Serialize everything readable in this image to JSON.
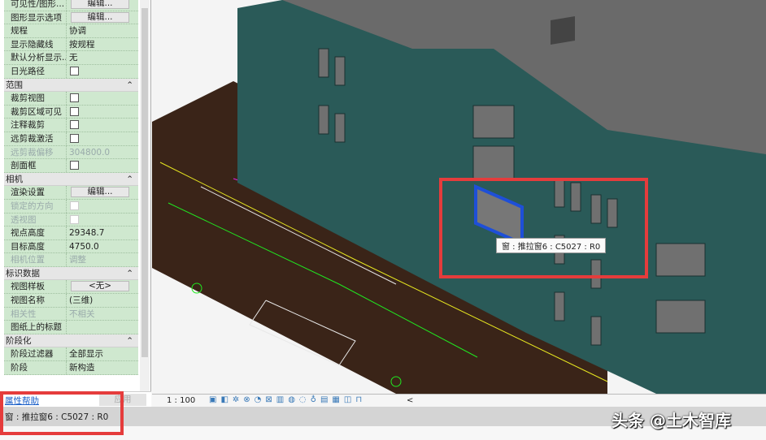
{
  "properties": {
    "rows": [
      {
        "type": "row",
        "key": "可见性/图形...",
        "button": "编辑..."
      },
      {
        "type": "row",
        "key": "图形显示选项",
        "button": "编辑..."
      },
      {
        "type": "row",
        "key": "规程",
        "value": "协调"
      },
      {
        "type": "row",
        "key": "显示隐藏线",
        "value": "按规程"
      },
      {
        "type": "row",
        "key": "默认分析显示...",
        "value": "无"
      },
      {
        "type": "row",
        "key": "日光路径",
        "checkbox": false
      },
      {
        "type": "header",
        "key": "范围"
      },
      {
        "type": "row",
        "key": "裁剪视图",
        "checkbox": false
      },
      {
        "type": "row",
        "key": "裁剪区域可见",
        "checkbox": false
      },
      {
        "type": "row",
        "key": "注释裁剪",
        "checkbox": false
      },
      {
        "type": "row",
        "key": "远剪裁激活",
        "checkbox": false
      },
      {
        "type": "row",
        "key": "远剪裁偏移",
        "value": "304800.0",
        "disabled": true
      },
      {
        "type": "row",
        "key": "剖面框",
        "checkbox": false
      },
      {
        "type": "header",
        "key": "相机"
      },
      {
        "type": "row",
        "key": "渲染设置",
        "button": "编辑..."
      },
      {
        "type": "row",
        "key": "锁定的方向",
        "checkbox": false,
        "disabled": true
      },
      {
        "type": "row",
        "key": "透视图",
        "checkbox": false,
        "disabled": true
      },
      {
        "type": "row",
        "key": "视点高度",
        "value": "29348.7"
      },
      {
        "type": "row",
        "key": "目标高度",
        "value": "4750.0"
      },
      {
        "type": "row",
        "key": "相机位置",
        "value": "调整",
        "disabled": true
      },
      {
        "type": "header",
        "key": "标识数据"
      },
      {
        "type": "row",
        "key": "视图样板",
        "button": "<无>"
      },
      {
        "type": "row",
        "key": "视图名称",
        "value": "(三维)"
      },
      {
        "type": "row",
        "key": "相关性",
        "value": "不相关",
        "disabled": true
      },
      {
        "type": "row",
        "key": "图纸上的标题",
        "value": ""
      },
      {
        "type": "header",
        "key": "阶段化"
      },
      {
        "type": "row",
        "key": "阶段过滤器",
        "value": "全部显示"
      },
      {
        "type": "row",
        "key": "阶段",
        "value": "新构造"
      }
    ],
    "help_link": "属性帮助",
    "apply_button": "应用"
  },
  "viewport": {
    "tooltip": "窗 : 推拉窗6 : C5027 : R0",
    "scale": "1 : 100",
    "collapse_arrow": "<"
  },
  "status_bar": {
    "text": "窗 : 推拉窗6 : C5027 : R0"
  },
  "watermark": "头条 @土木智库",
  "colors": {
    "building": "#2a5a58",
    "ground": "#3a2418",
    "highlight": "#1e4fd8",
    "annotation": "#e53c3c",
    "property_bg": "#cfe8cf"
  }
}
